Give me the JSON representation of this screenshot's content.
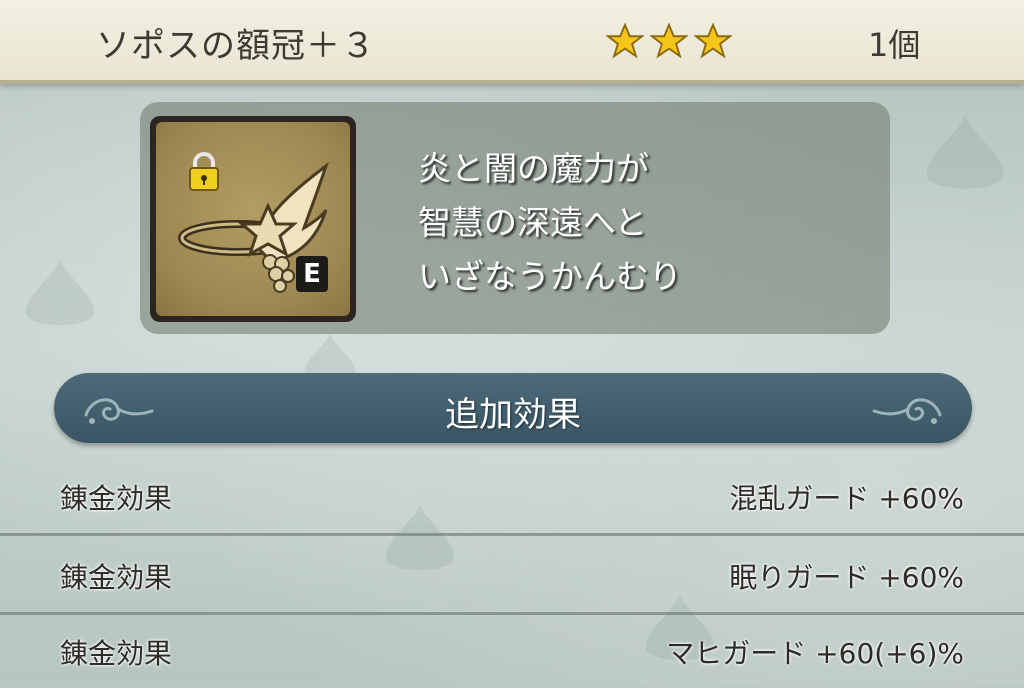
{
  "header": {
    "item_name": "ソポスの額冠＋３",
    "rarity_stars": 3,
    "count": "1個"
  },
  "item": {
    "icon": "winged-crown-icon",
    "locked": true,
    "equipped_badge": "E",
    "description_lines": [
      "炎と闇の魔力が",
      "智慧の深遠へと",
      "いざなうかんむり"
    ]
  },
  "section": {
    "title": "追加効果"
  },
  "effects": [
    {
      "label": "錬金効果",
      "value": "混乱ガード +60%"
    },
    {
      "label": "錬金効果",
      "value": "眠りガード +60%"
    },
    {
      "label": "錬金効果",
      "value": "マヒガード +60(+6)%"
    }
  ],
  "colors": {
    "star": "#f5c518",
    "section_bg": "#3f5b6a",
    "header_bg": "#efeadb"
  }
}
